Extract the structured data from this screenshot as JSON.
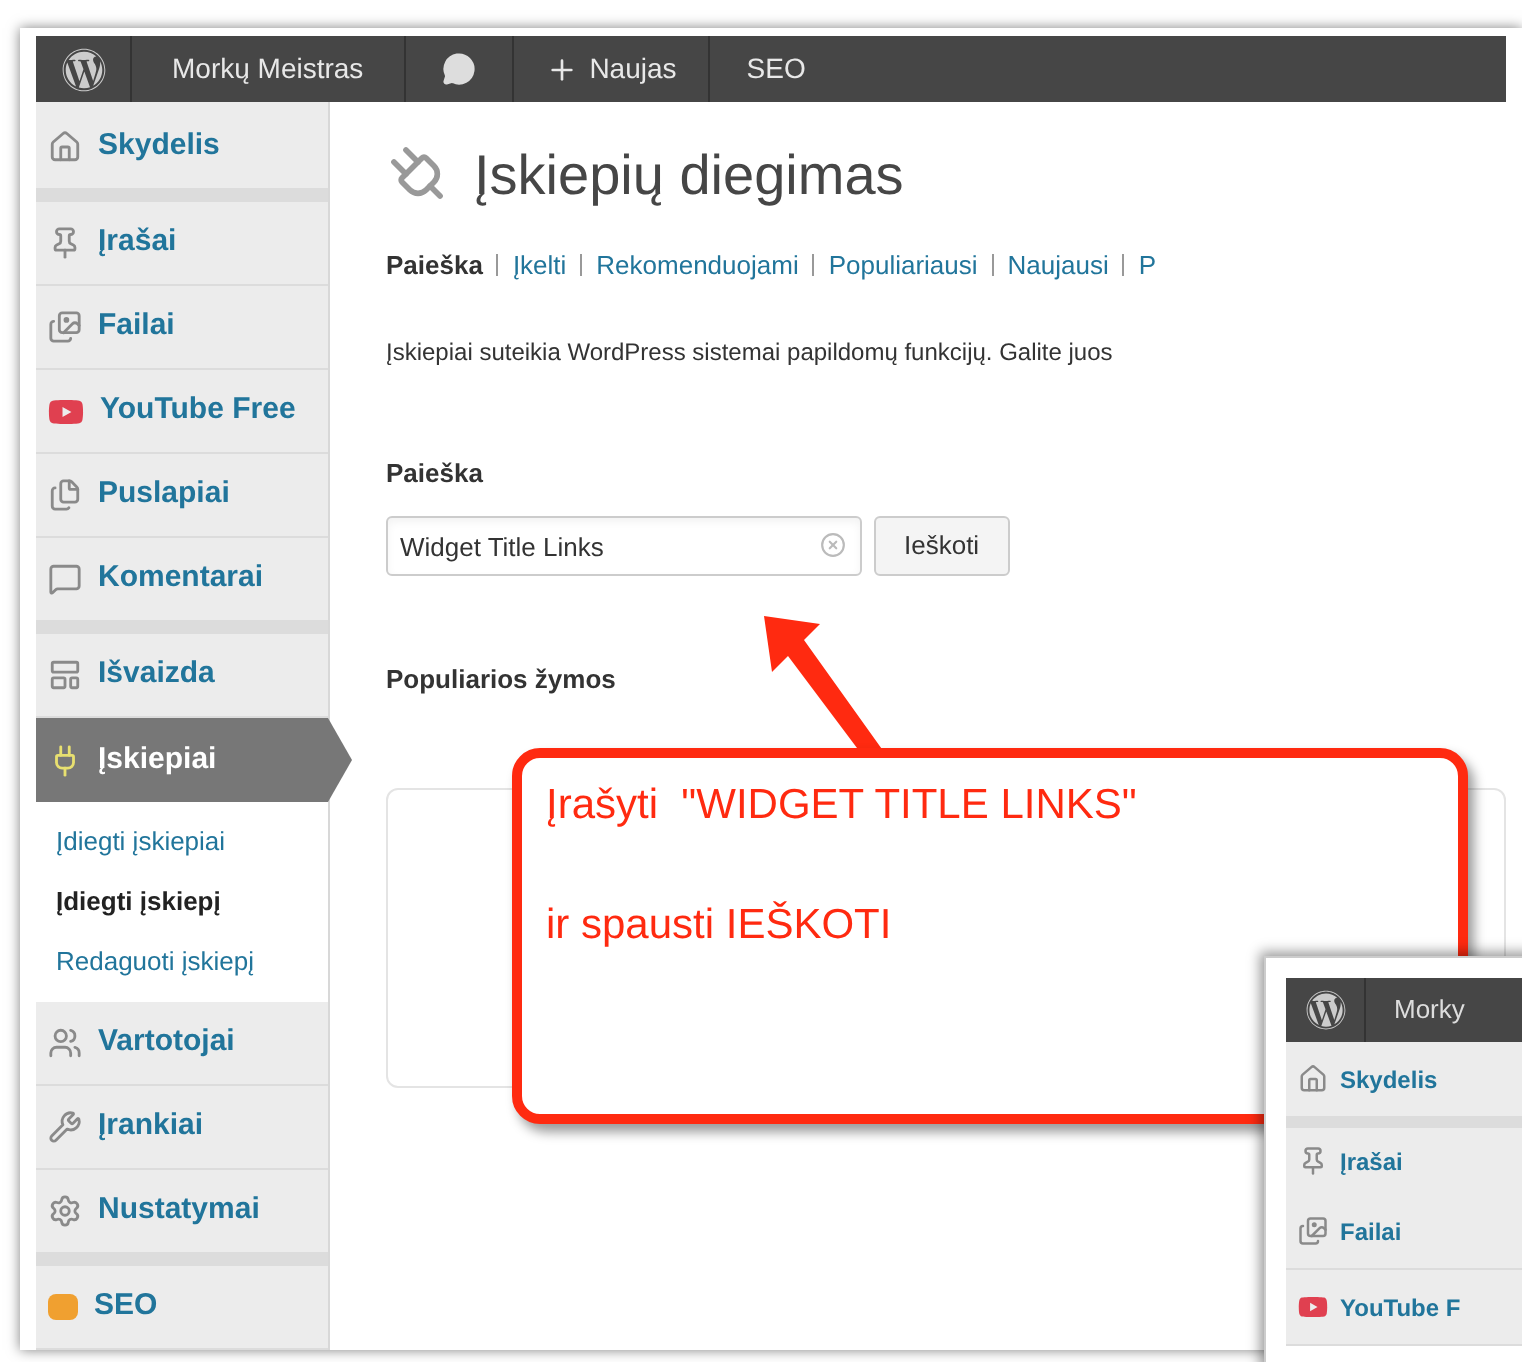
{
  "admin_bar": {
    "site_name": "Morkų Meistras",
    "new_label": "Naujas",
    "seo_label": "SEO"
  },
  "sidebar": {
    "groups": [
      [
        {
          "label": "Skydelis",
          "selected": false
        }
      ],
      [
        {
          "label": "Įrašai",
          "selected": false
        },
        {
          "label": "Failai",
          "selected": false
        },
        {
          "label": "YouTube Free",
          "selected": false
        },
        {
          "label": "Puslapiai",
          "selected": false
        },
        {
          "label": "Komentarai",
          "selected": false
        }
      ],
      [
        {
          "label": "Išvaizda",
          "selected": false
        },
        {
          "label": "Įskiepiai",
          "selected": true,
          "children": [
            {
              "label": "Įdiegti įskiepiai",
              "selected": false
            },
            {
              "label": "Įdiegti įskiepį",
              "selected": true
            },
            {
              "label": "Redaguoti įskiepį",
              "selected": false
            }
          ]
        },
        {
          "label": "Vartotojai",
          "selected": false
        },
        {
          "label": "Įrankiai",
          "selected": false
        },
        {
          "label": "Nustatymai",
          "selected": false
        }
      ],
      [
        {
          "label": "SEO",
          "selected": false
        }
      ]
    ]
  },
  "page": {
    "title": "Įskiepių diegimas",
    "tabs": [
      {
        "label": "Paieška",
        "selected": true
      },
      {
        "label": "Įkelti",
        "selected": false
      },
      {
        "label": "Rekomenduojami",
        "selected": false
      },
      {
        "label": "Populiariausi",
        "selected": false
      },
      {
        "label": "Naujausi",
        "selected": false
      },
      {
        "label": "P",
        "selected": false
      }
    ],
    "description": "Įskiepiai suteikia WordPress sistemai papildomų funkcijų. Galite juos",
    "search_heading": "Paieška",
    "search": {
      "value": "Widget Title Links"
    },
    "search_button": "Ieškoti",
    "tags_heading": "Populiarios žymos"
  },
  "callout": {
    "lines": [
      "Įrašyti  \"WIDGET TITLE LINKS\"",
      "ir spausti IEŠKOTI"
    ]
  },
  "inset_screenshot": {
    "site_name": "Morky",
    "items": [
      "Skydelis",
      "Įrašai",
      "Failai",
      "YouTube F"
    ]
  }
}
